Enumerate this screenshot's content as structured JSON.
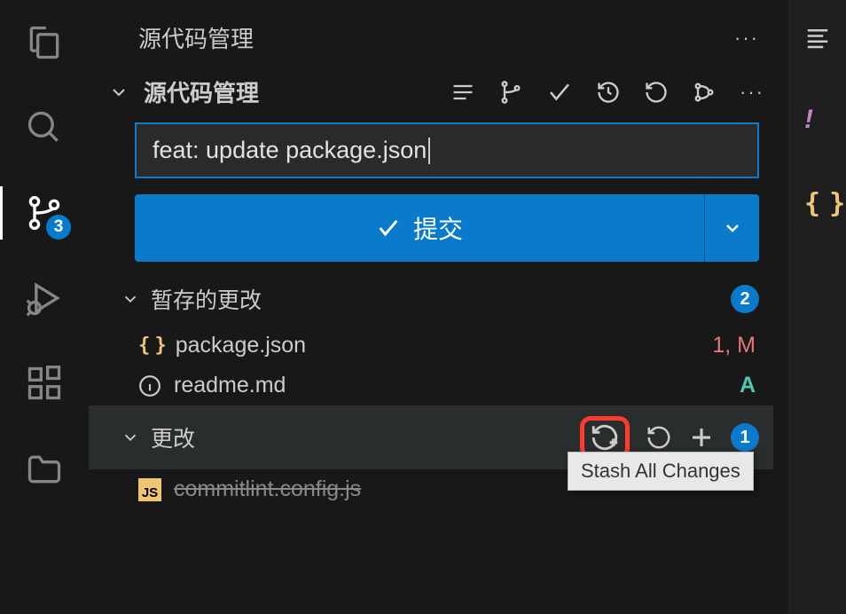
{
  "title": "源代码管理",
  "activityBar": {
    "badge": "3"
  },
  "repo": {
    "title": "源代码管理",
    "commitMessage": "feat: update package.json",
    "commitButton": "提交"
  },
  "staged": {
    "title": "暂存的更改",
    "count": "2",
    "files": [
      {
        "name": "package.json",
        "status": "1, M",
        "icon": "json"
      },
      {
        "name": "readme.md",
        "status": "A",
        "icon": "info"
      }
    ]
  },
  "changes": {
    "title": "更改",
    "count": "1",
    "files": [
      {
        "name": "commitlint.config.js",
        "status": "",
        "icon": "js"
      }
    ]
  },
  "tooltip": "Stash All Changes"
}
